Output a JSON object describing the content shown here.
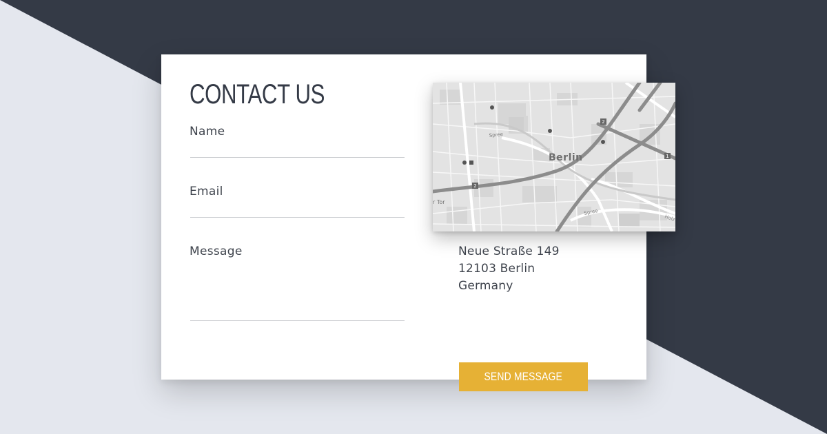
{
  "colors": {
    "dark_background": "#343a46",
    "light_background": "#e4e7ee",
    "card": "#ffffff",
    "accent": "#e6b135",
    "text": "#3e434c"
  },
  "form": {
    "title": "CONTACT US",
    "fields": {
      "name_label": "Name",
      "email_label": "Email",
      "message_label": "Message"
    },
    "send_button_label": "SEND MESSAGE"
  },
  "map": {
    "city_label": "Berlin",
    "labels": {
      "spree_1": "Spree",
      "spree_2": "Spree",
      "tor": "r Tor",
      "holz": "Holz"
    },
    "route_badges": [
      "2",
      "2",
      "1"
    ]
  },
  "address": {
    "street": "Neue Straße 149",
    "postal_city": "12103 Berlin",
    "country": "Germany"
  }
}
